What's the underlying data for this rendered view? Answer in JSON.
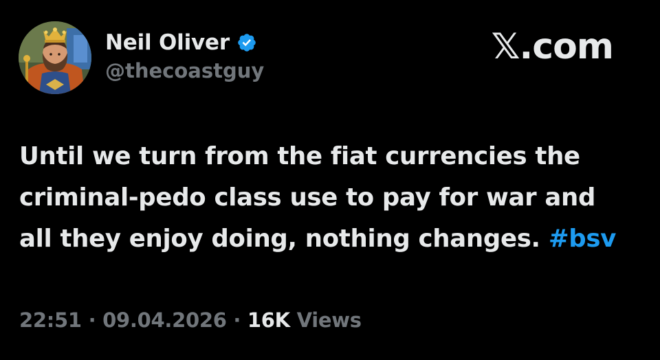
{
  "author": {
    "display_name": "Neil Oliver",
    "handle": "@thecoastguy",
    "verified": true,
    "avatar_icon": "crowned-king-portrait-avatar"
  },
  "brand": {
    "label": "𝕏.com"
  },
  "tweet": {
    "lines": [
      "Until we turn from the fiat currencies the",
      "criminal-pedo class use to pay for war and",
      "all they enjoy doing, nothing changes."
    ],
    "hashtag": "#bsv"
  },
  "meta": {
    "time": "22:51",
    "separator": "·",
    "date": "09.04.2026",
    "views_count": "16K",
    "views_label": "Views"
  },
  "colors": {
    "background": "#000000",
    "text_primary": "#e7e9ea",
    "text_secondary": "#71767b",
    "accent_link": "#1d9bf0",
    "verified_badge": "#1d9bf0"
  }
}
